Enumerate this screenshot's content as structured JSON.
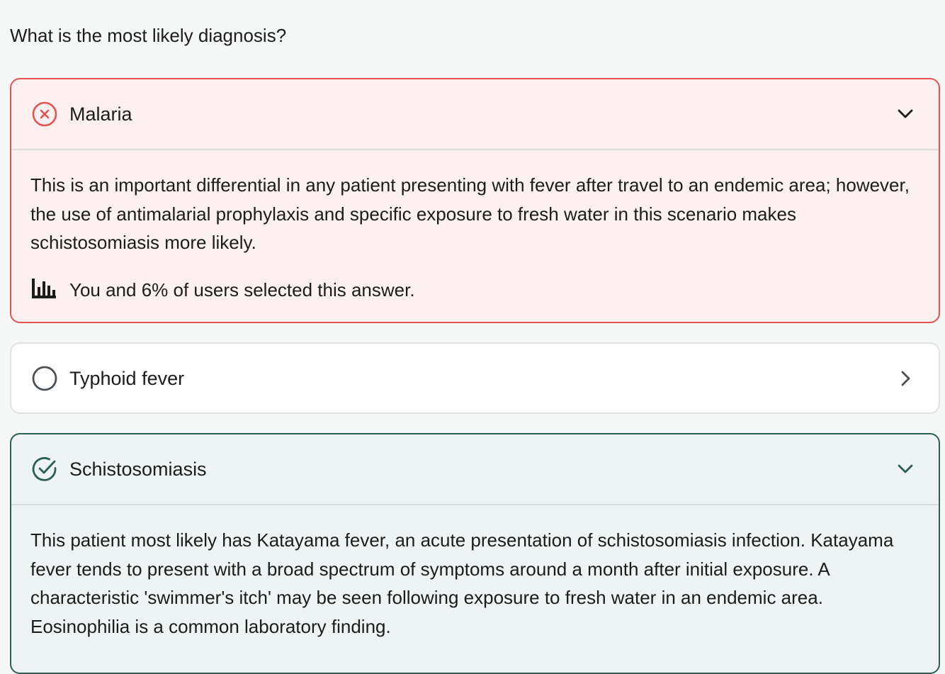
{
  "question": "What is the most likely diagnosis?",
  "options": [
    {
      "label": "Malaria",
      "state": "incorrect",
      "status_icon": "x-circle-icon",
      "chevron": "chevron-down-icon",
      "explanation": "This is an important differential in any patient presenting with fever after travel to an endemic area; however, the use of antimalarial prophylaxis and specific exposure to fresh water in this scenario makes schistosomiasis more likely.",
      "stats_icon": "bar-chart-icon",
      "stats_text": "You and 6% of users selected this answer."
    },
    {
      "label": "Typhoid fever",
      "state": "unselected",
      "status_icon": "empty-circle-icon",
      "chevron": "chevron-right-icon"
    },
    {
      "label": "Schistosomiasis",
      "state": "correct",
      "status_icon": "check-circle-icon",
      "chevron": "chevron-down-icon",
      "explanation": "This patient most likely has Katayama fever, an acute presentation of schistosomiasis infection. Katayama fever tends to present with a broad spectrum of symptoms around a month after initial exposure. A characteristic 'swimmer's itch' may be seen following exposure to fresh water in an endemic area. Eosinophilia is a common laboratory finding."
    }
  ],
  "colors": {
    "incorrect_border": "#e3534f",
    "incorrect_bg": "#fdf0f0",
    "correct_border": "#2c5f52",
    "correct_bg": "#eef4f3",
    "neutral_icon": "#4a4f55"
  }
}
